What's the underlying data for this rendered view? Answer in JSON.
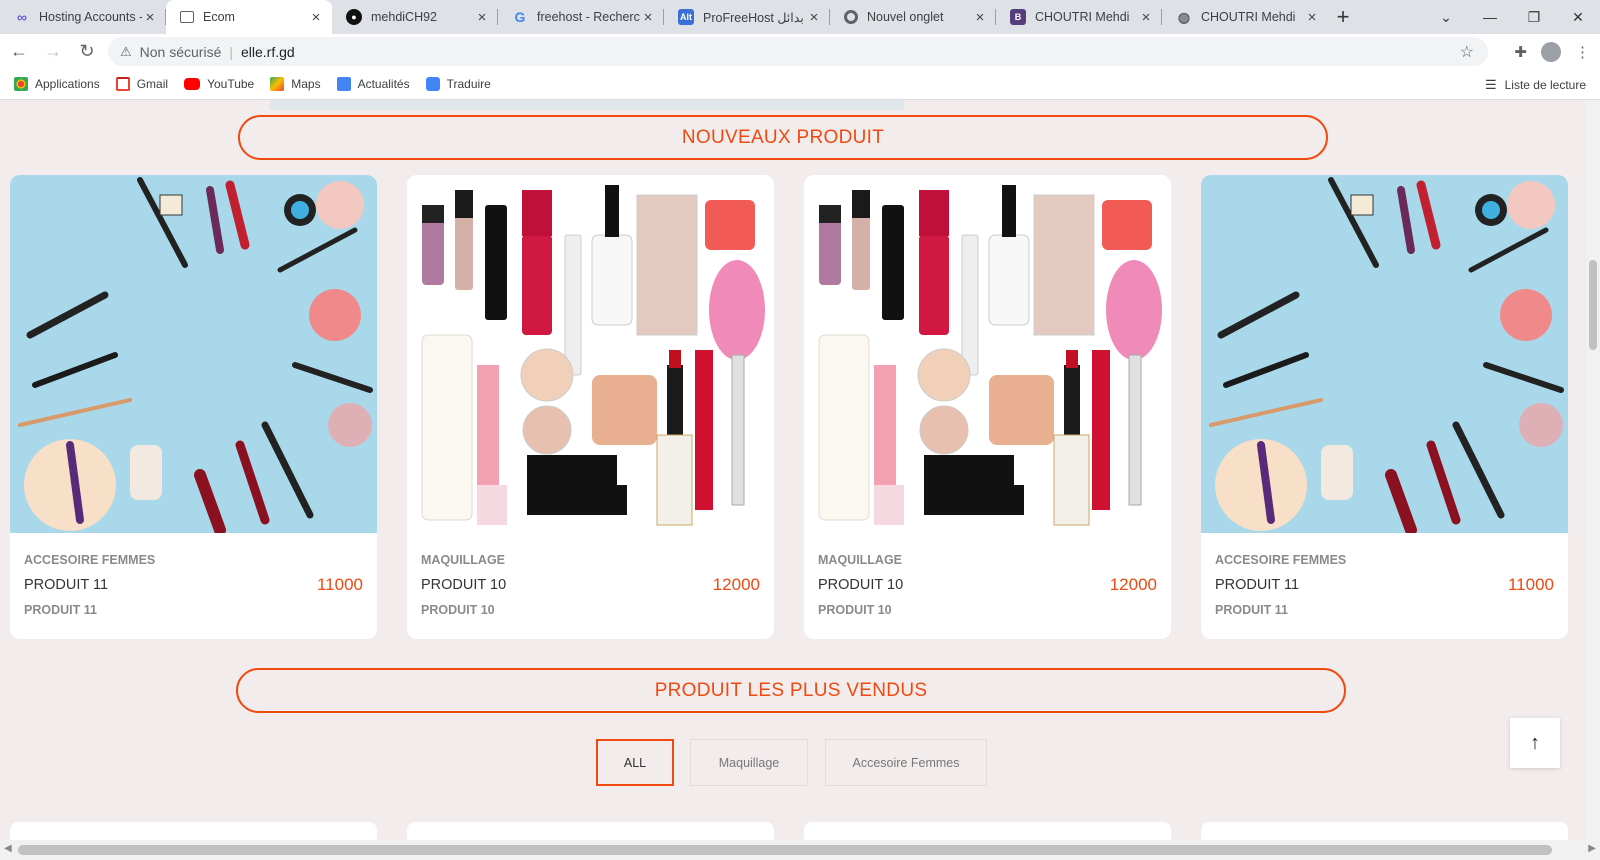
{
  "browser": {
    "tabs": [
      {
        "title": "Hosting Accounts -",
        "favicon": "infinity-icon",
        "color": "#6b5bd6",
        "active": false
      },
      {
        "title": "Ecom",
        "favicon": "page-icon",
        "color": "#5f6368",
        "active": true
      },
      {
        "title": "mehdiCH92",
        "favicon": "github-icon",
        "color": "#111111",
        "active": false
      },
      {
        "title": "freehost - Recherch",
        "favicon": "google-icon",
        "color": "#4285f4",
        "active": false
      },
      {
        "title": "ProFreeHost بدائل",
        "favicon": "alt-icon",
        "color": "#3b6fd8",
        "active": false
      },
      {
        "title": "Nouvel onglet",
        "favicon": "chrome-icon",
        "color": "#5f6368",
        "active": false
      },
      {
        "title": "CHOUTRI Mehdi",
        "favicon": "bootstrap-icon",
        "color": "#563d7c",
        "active": false
      },
      {
        "title": "CHOUTRI Mehdi",
        "favicon": "globe-icon",
        "color": "#5f6368",
        "active": false
      }
    ],
    "address": {
      "security_label": "Non sécurisé",
      "url": "elle.rf.gd"
    },
    "bookmarks": [
      {
        "label": "Applications",
        "icon": "apps-grid-icon",
        "color": "#ea4335"
      },
      {
        "label": "Gmail",
        "icon": "gmail-icon",
        "color": "#ea4335"
      },
      {
        "label": "YouTube",
        "icon": "youtube-icon",
        "color": "#ff0000"
      },
      {
        "label": "Maps",
        "icon": "maps-icon",
        "color": "#34a853"
      },
      {
        "label": "Actualités",
        "icon": "news-icon",
        "color": "#4285f4"
      },
      {
        "label": "Traduire",
        "icon": "translate-icon",
        "color": "#4285f4"
      }
    ],
    "reading_list": "Liste de lecture"
  },
  "sections": {
    "new_products_title": "NOUVEAUX PRODUIT",
    "best_sellers_title": "PRODUIT LES PLUS VENDUS"
  },
  "products": [
    {
      "category": "ACCESOIRE FEMMES",
      "name": "PRODUIT 11",
      "price": "11000",
      "subtitle": "PRODUIT 11",
      "image": "blue-makeup-flatlay"
    },
    {
      "category": "MAQUILLAGE",
      "name": "PRODUIT 10",
      "price": "12000",
      "subtitle": "PRODUIT 10",
      "image": "white-makeup-collection"
    },
    {
      "category": "MAQUILLAGE",
      "name": "PRODUIT 10",
      "price": "12000",
      "subtitle": "PRODUIT 10",
      "image": "white-makeup-collection"
    },
    {
      "category": "ACCESOIRE FEMMES",
      "name": "PRODUIT 11",
      "price": "11000",
      "subtitle": "PRODUIT 11",
      "image": "blue-makeup-flatlay"
    }
  ],
  "filters": [
    {
      "label": "ALL",
      "active": true
    },
    {
      "label": "Maquillage",
      "active": false
    },
    {
      "label": "Accesoire Femmes",
      "active": false
    }
  ],
  "back_to_top": "↑",
  "colors": {
    "accent": "#f04a10",
    "page_bg": "#f3ecec"
  }
}
